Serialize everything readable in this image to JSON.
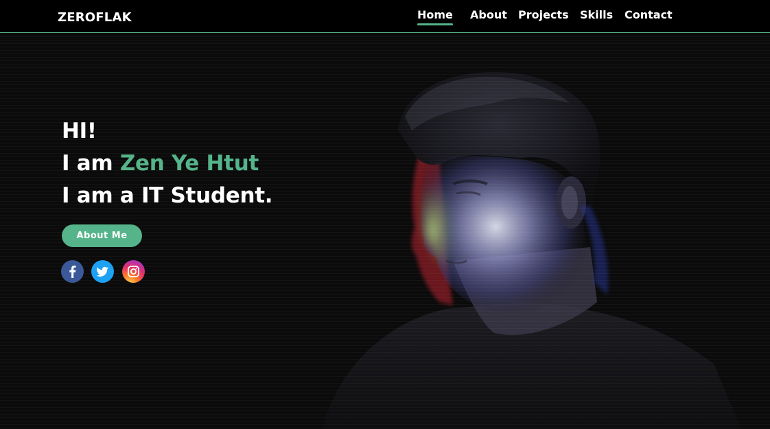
{
  "navbar": {
    "brand": "ZEROFLAK",
    "links": [
      {
        "label": "Home",
        "active": true
      },
      {
        "label": "About",
        "active": false
      },
      {
        "label": "Projects",
        "active": false
      },
      {
        "label": "Skills",
        "active": false
      },
      {
        "label": "Contact",
        "active": false
      }
    ]
  },
  "hero": {
    "greeting": "HI!",
    "intro_prefix": "I am ",
    "name": "Zen Ye Htut",
    "role_line": "I am a IT Student.",
    "cta_label": "About Me"
  },
  "socials": [
    {
      "icon": "facebook-icon"
    },
    {
      "icon": "twitter-icon"
    },
    {
      "icon": "instagram-icon"
    }
  ],
  "colors": {
    "accent": "#55b48a",
    "background": "#0b0b0b",
    "navbar": "#000000",
    "text": "#ffffff"
  }
}
